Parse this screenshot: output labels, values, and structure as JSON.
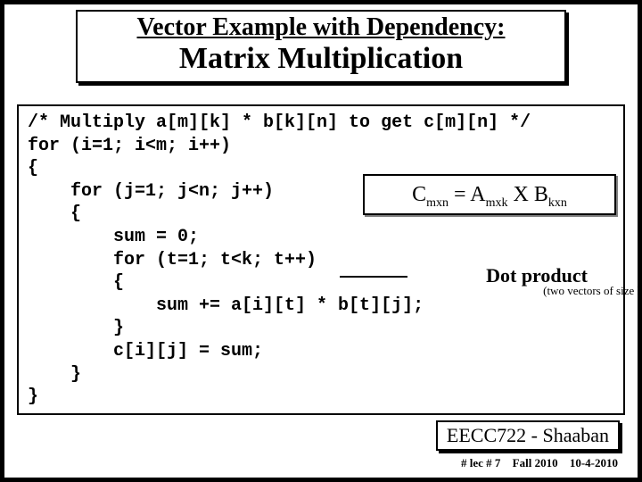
{
  "title": {
    "line1": "Vector Example with Dependency:",
    "line2": "Matrix Multiplication"
  },
  "code": {
    "l1": "/* Multiply a[m][k] * b[k][n] to get c[m][n] */",
    "l2": "for (i=1; i<m; i++)",
    "l3": "{",
    "l4": "    for (j=1; j<n; j++)",
    "l5": "    {",
    "l6": "        sum = 0;",
    "l7": "        for (t=1; t<k; t++)",
    "l8": "        {",
    "l9": "            sum += a[i][t] * b[t][j];",
    "l10": "        }",
    "l11": "        c[i][j] = sum;",
    "l12": "    }",
    "l13": "}"
  },
  "equation": {
    "C": "C",
    "Csub": "mxn",
    "eq": " = ",
    "A": "A",
    "Asub": "mxk",
    "X": "  X  ",
    "B": "B",
    "Bsub": "kxn"
  },
  "dotproduct": {
    "label": "Dot product",
    "sub": "(two vectors of size k)"
  },
  "footer": {
    "course": "EECC722 - Shaaban",
    "lec": "#  lec # 7",
    "term": "Fall 2010",
    "date": "10-4-2010"
  }
}
